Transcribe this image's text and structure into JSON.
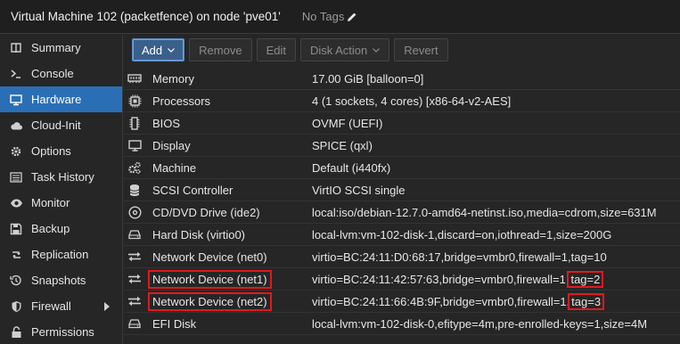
{
  "header": {
    "title": "Virtual Machine 102 (packetfence) on node 'pve01'",
    "tags_label": "No Tags"
  },
  "sidebar": {
    "items": [
      {
        "label": "Summary",
        "icon": "book-icon"
      },
      {
        "label": "Console",
        "icon": "terminal-icon"
      },
      {
        "label": "Hardware",
        "icon": "desktop-icon",
        "active": true
      },
      {
        "label": "Cloud-Init",
        "icon": "cloud-icon"
      },
      {
        "label": "Options",
        "icon": "gear-icon"
      },
      {
        "label": "Task History",
        "icon": "list-icon"
      },
      {
        "label": "Monitor",
        "icon": "eye-icon"
      },
      {
        "label": "Backup",
        "icon": "floppy-icon"
      },
      {
        "label": "Replication",
        "icon": "retweet-icon"
      },
      {
        "label": "Snapshots",
        "icon": "history-icon"
      },
      {
        "label": "Firewall",
        "icon": "shield-icon",
        "expandable": true
      },
      {
        "label": "Permissions",
        "icon": "unlock-icon"
      }
    ]
  },
  "toolbar": {
    "add": "Add",
    "remove": "Remove",
    "edit": "Edit",
    "disk_action": "Disk Action",
    "revert": "Revert"
  },
  "hardware": [
    {
      "name": "Memory",
      "value": "17.00 GiB [balloon=0]",
      "icon": "memory-icon"
    },
    {
      "name": "Processors",
      "value": "4 (1 sockets, 4 cores) [x86-64-v2-AES]",
      "icon": "cpu-icon"
    },
    {
      "name": "BIOS",
      "value": "OVMF (UEFI)",
      "icon": "microchip-icon"
    },
    {
      "name": "Display",
      "value": "SPICE (qxl)",
      "icon": "monitor-icon"
    },
    {
      "name": "Machine",
      "value": "Default (i440fx)",
      "icon": "cogs-icon"
    },
    {
      "name": "SCSI Controller",
      "value": "VirtIO SCSI single",
      "icon": "database-icon"
    },
    {
      "name": "CD/DVD Drive (ide2)",
      "value": "local:iso/debian-12.7.0-amd64-netinst.iso,media=cdrom,size=631M",
      "icon": "cdrom-icon"
    },
    {
      "name": "Hard Disk (virtio0)",
      "value": "local-lvm:vm-102-disk-1,discard=on,iothread=1,size=200G",
      "icon": "harddisk-icon"
    },
    {
      "name": "Network Device (net0)",
      "value": "virtio=BC:24:11:D0:68:17,bridge=vmbr0,firewall=1,tag=10",
      "icon": "exchange-icon"
    },
    {
      "name": "Network Device (net1)",
      "value_main": "virtio=BC:24:11:42:57:63,bridge=vmbr0,firewall=1,",
      "value_tag": "tag=2",
      "icon": "exchange-icon"
    },
    {
      "name": "Network Device (net2)",
      "value_main": "virtio=BC:24:11:66:4B:9F,bridge=vmbr0,firewall=1,",
      "value_tag": "tag=3",
      "icon": "exchange-icon"
    },
    {
      "name": "EFI Disk",
      "value": "local-lvm:vm-102-disk-0,efitype=4m,pre-enrolled-keys=1,size=4M",
      "icon": "harddisk-icon"
    }
  ],
  "colors": {
    "accent": "#2a6fb5",
    "highlight": "#e0191f"
  }
}
